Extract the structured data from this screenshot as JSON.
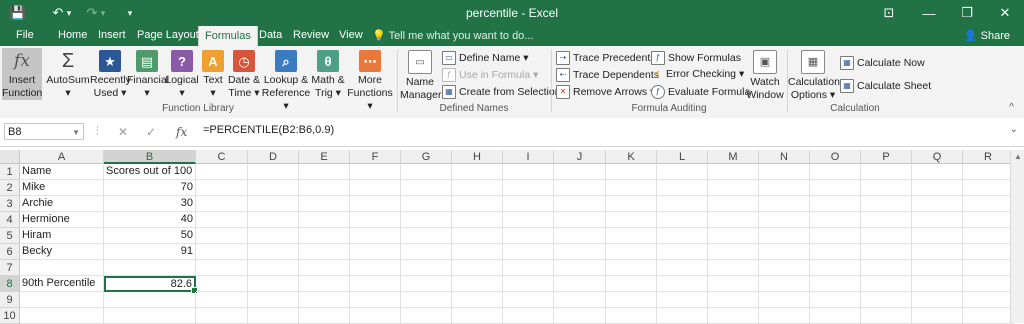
{
  "titlebar": {
    "title": "percentile - Excel",
    "qat": {
      "save": "💾",
      "undo": "↶",
      "undo_dd": "▾",
      "redo": "↷",
      "redo_dd": "▾",
      "customize": "▾"
    },
    "controls": {
      "ribbon_display": "⊡",
      "minimize": "—",
      "restore": "❐",
      "close": "✕"
    }
  },
  "tabs": [
    "File",
    "Home",
    "Insert",
    "Page Layout",
    "Formulas",
    "Data",
    "Review",
    "View"
  ],
  "active_tab": "Formulas",
  "tell_me": "Tell me what you want to do...",
  "share": "Share",
  "ribbon": {
    "function_library": {
      "label": "Function Library",
      "insert_function": [
        "Insert",
        "Function"
      ],
      "autosum": [
        "AutoSum",
        "▾"
      ],
      "recently_used": [
        "Recently",
        "Used ▾"
      ],
      "financial": [
        "Financial",
        "▾"
      ],
      "logical": [
        "Logical",
        "▾"
      ],
      "text": [
        "Text",
        "▾"
      ],
      "date_time": [
        "Date &",
        "Time ▾"
      ],
      "lookup": [
        "Lookup &",
        "Reference ▾"
      ],
      "math": [
        "Math &",
        "Trig ▾"
      ],
      "more": [
        "More",
        "Functions ▾"
      ]
    },
    "defined_names": {
      "label": "Defined Names",
      "name_manager": [
        "Name",
        "Manager"
      ],
      "define_name": "Define Name ▾",
      "use_in_formula": "Use in Formula ▾",
      "create_from_selection": "Create from Selection"
    },
    "formula_auditing": {
      "label": "Formula Auditing",
      "trace_precedents": "Trace Precedents",
      "trace_dependents": "Trace Dependents",
      "remove_arrows": "Remove Arrows ▾",
      "show_formulas": "Show Formulas",
      "error_checking": "Error Checking ▾",
      "evaluate_formula": "Evaluate Formula",
      "watch_window": [
        "Watch",
        "Window"
      ]
    },
    "calculation": {
      "label": "Calculation",
      "options": [
        "Calculation",
        "Options ▾"
      ],
      "calculate_now": "Calculate Now",
      "calculate_sheet": "Calculate Sheet"
    },
    "collapse": "^"
  },
  "formula_bar": {
    "name_box": "B8",
    "cancel": "✕",
    "enter": "✓",
    "fx": "fx",
    "formula": "=PERCENTILE(B2:B6,0.9)",
    "expand": "⌄"
  },
  "sheet": {
    "columns": [
      "A",
      "B",
      "C",
      "D",
      "E",
      "F",
      "G",
      "H",
      "I",
      "J",
      "K",
      "L",
      "M",
      "N",
      "O",
      "P",
      "Q",
      "R"
    ],
    "rows": [
      "1",
      "2",
      "3",
      "4",
      "5",
      "6",
      "7",
      "8",
      "9",
      "10"
    ],
    "selected_cell": "B8",
    "cells": {
      "A1": "Name",
      "B1": "Scores out of 100",
      "A2": "Mike",
      "B2": "70",
      "A3": "Archie",
      "B3": "30",
      "A4": "Hermione",
      "B4": "40",
      "A5": "Hiram",
      "B5": "50",
      "A6": "Becky",
      "B6": "91",
      "A8": "90th Percentile",
      "B8": "82.6"
    }
  },
  "colors": {
    "excel_green": "#217346",
    "ribbon_bg": "#f3f3f3"
  }
}
